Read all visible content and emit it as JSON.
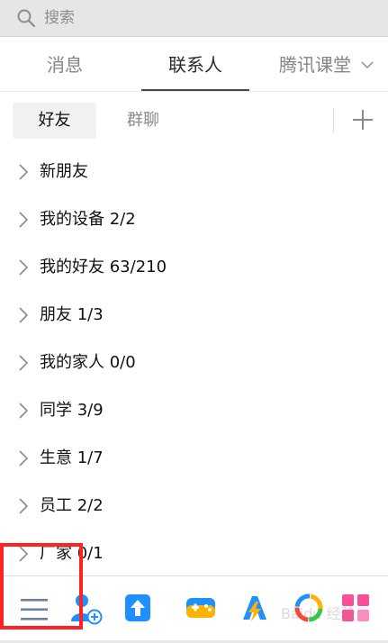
{
  "search": {
    "placeholder": "搜索"
  },
  "tabs": [
    {
      "label": "消息"
    },
    {
      "label": "联系人"
    },
    {
      "label": "腾讯课堂"
    }
  ],
  "subtabs": [
    {
      "label": "好友"
    },
    {
      "label": "群聊"
    }
  ],
  "groups": [
    {
      "label": "新朋友"
    },
    {
      "label": "我的设备 2/2"
    },
    {
      "label": "我的好友 63/210"
    },
    {
      "label": "朋友 1/3"
    },
    {
      "label": "我的家人 0/0"
    },
    {
      "label": "同学 3/9"
    },
    {
      "label": "生意 1/7"
    },
    {
      "label": "员工 2/2"
    },
    {
      "label": "厂家 0/1"
    }
  ],
  "bottom_bar": {
    "icons": [
      "menu-icon",
      "add-contact-icon",
      "upload-icon",
      "game-icon",
      "thunder-icon",
      "app-icon",
      "grid-app-icon"
    ]
  },
  "watermark": "Baidu 经验",
  "colors": {
    "active_tab": "#2b2b2b",
    "inactive_tab": "#858585",
    "highlight": "#ff2222",
    "accent_blue": "#1e90ff",
    "accent_pink": "#ff4d9a"
  }
}
